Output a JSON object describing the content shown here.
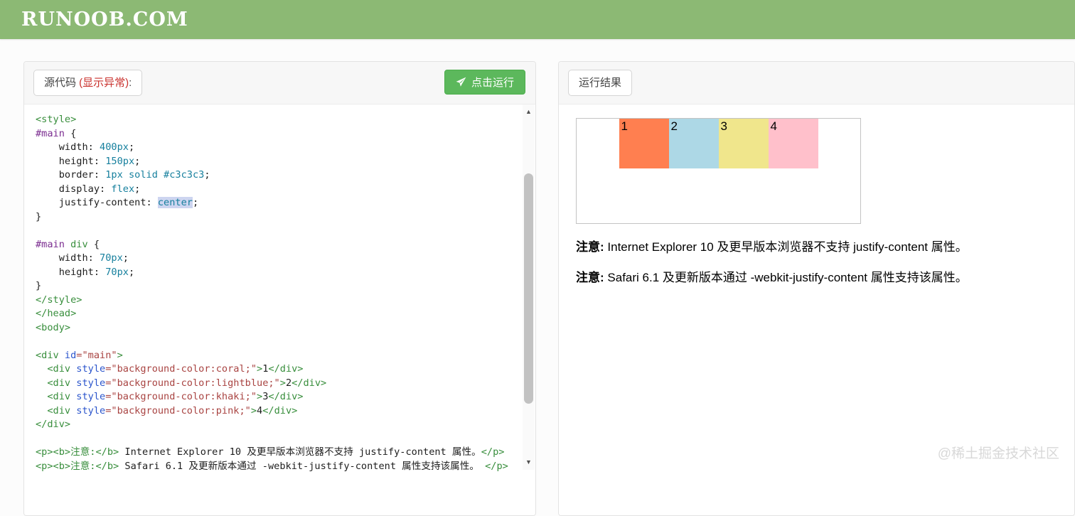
{
  "header": {
    "logo": "RUNOOB.COM",
    "bg_color": "#8CB974"
  },
  "source_panel": {
    "tab_label_prefix": "源代码 ",
    "tab_label_warn": "(显示异常)",
    "tab_label_suffix": ":",
    "run_button_label": "点击运行",
    "run_button_color": "#5CB85C",
    "code_lines": [
      [
        {
          "t": "<style>",
          "c": "tag"
        }
      ],
      [
        {
          "t": "#main",
          "c": "sel"
        },
        {
          "t": " {",
          "c": "pln"
        }
      ],
      [
        {
          "t": "    width: ",
          "c": "pln"
        },
        {
          "t": "400px",
          "c": "val"
        },
        {
          "t": ";",
          "c": "pln"
        }
      ],
      [
        {
          "t": "    height: ",
          "c": "pln"
        },
        {
          "t": "150px",
          "c": "val"
        },
        {
          "t": ";",
          "c": "pln"
        }
      ],
      [
        {
          "t": "    border: ",
          "c": "pln"
        },
        {
          "t": "1px solid #c3c3c3",
          "c": "val"
        },
        {
          "t": ";",
          "c": "pln"
        }
      ],
      [
        {
          "t": "    display: ",
          "c": "pln"
        },
        {
          "t": "flex",
          "c": "val"
        },
        {
          "t": ";",
          "c": "pln"
        }
      ],
      [
        {
          "t": "    justify-content: ",
          "c": "pln"
        },
        {
          "t": "center",
          "c": "val hl"
        },
        {
          "t": ";",
          "c": "pln"
        }
      ],
      [
        {
          "t": "}",
          "c": "pln"
        }
      ],
      [],
      [
        {
          "t": "#main",
          "c": "sel"
        },
        {
          "t": " ",
          "c": "pln"
        },
        {
          "t": "div",
          "c": "tag"
        },
        {
          "t": " {",
          "c": "pln"
        }
      ],
      [
        {
          "t": "    width: ",
          "c": "pln"
        },
        {
          "t": "70px",
          "c": "val"
        },
        {
          "t": ";",
          "c": "pln"
        }
      ],
      [
        {
          "t": "    height: ",
          "c": "pln"
        },
        {
          "t": "70px",
          "c": "val"
        },
        {
          "t": ";",
          "c": "pln"
        }
      ],
      [
        {
          "t": "}",
          "c": "pln"
        }
      ],
      [
        {
          "t": "</style>",
          "c": "tag"
        }
      ],
      [
        {
          "t": "</head>",
          "c": "tag"
        }
      ],
      [
        {
          "t": "<body>",
          "c": "tag"
        }
      ],
      [],
      [
        {
          "t": "<div ",
          "c": "tag"
        },
        {
          "t": "id",
          "c": "attr"
        },
        {
          "t": "=\"main\"",
          "c": "str"
        },
        {
          "t": ">",
          "c": "tag"
        }
      ],
      [
        {
          "t": "  <div ",
          "c": "tag"
        },
        {
          "t": "style",
          "c": "attr"
        },
        {
          "t": "=\"background-color:coral;\"",
          "c": "str"
        },
        {
          "t": ">",
          "c": "tag"
        },
        {
          "t": "1",
          "c": "pln"
        },
        {
          "t": "</div>",
          "c": "tag"
        }
      ],
      [
        {
          "t": "  <div ",
          "c": "tag"
        },
        {
          "t": "style",
          "c": "attr"
        },
        {
          "t": "=\"background-color:lightblue;\"",
          "c": "str"
        },
        {
          "t": ">",
          "c": "tag"
        },
        {
          "t": "2",
          "c": "pln"
        },
        {
          "t": "</div>",
          "c": "tag"
        }
      ],
      [
        {
          "t": "  <div ",
          "c": "tag"
        },
        {
          "t": "style",
          "c": "attr"
        },
        {
          "t": "=\"background-color:khaki;\"",
          "c": "str"
        },
        {
          "t": ">",
          "c": "tag"
        },
        {
          "t": "3",
          "c": "pln"
        },
        {
          "t": "</div>",
          "c": "tag"
        }
      ],
      [
        {
          "t": "  <div ",
          "c": "tag"
        },
        {
          "t": "style",
          "c": "attr"
        },
        {
          "t": "=\"background-color:pink;\"",
          "c": "str"
        },
        {
          "t": ">",
          "c": "tag"
        },
        {
          "t": "4",
          "c": "pln"
        },
        {
          "t": "</div>",
          "c": "tag"
        }
      ],
      [
        {
          "t": "</div>",
          "c": "tag"
        }
      ],
      [],
      [
        {
          "t": "<p><b>注意:</b>",
          "c": "tag"
        },
        {
          "t": " Internet Explorer 10 及更早版本浏览器不支持 justify-content 属性。",
          "c": "pln"
        },
        {
          "t": "</p>",
          "c": "tag"
        }
      ],
      [
        {
          "t": "<p><b>注意:</b>",
          "c": "tag"
        },
        {
          "t": " Safari 6.1 及更新版本通过 -webkit-justify-content 属性支持该属性。 ",
          "c": "pln"
        },
        {
          "t": "</p>",
          "c": "tag"
        }
      ]
    ]
  },
  "result_panel": {
    "tab_label": "运行结果",
    "flex_demo": {
      "container_border_color": "#c3c3c3",
      "items": [
        {
          "label": "1",
          "name": "coral",
          "color": "#FF7F50"
        },
        {
          "label": "2",
          "name": "lightblue",
          "color": "#ADD8E6"
        },
        {
          "label": "3",
          "name": "khaki",
          "color": "#F0E68C"
        },
        {
          "label": "4",
          "name": "pink",
          "color": "#FFC0CB"
        }
      ]
    },
    "notes": [
      {
        "bold": "注意:",
        "text": " Internet Explorer 10 及更早版本浏览器不支持 justify-content 属性。"
      },
      {
        "bold": "注意:",
        "text": " Safari 6.1 及更新版本通过 -webkit-justify-content 属性支持该属性。"
      }
    ]
  },
  "watermark": "@稀土掘金技术社区"
}
